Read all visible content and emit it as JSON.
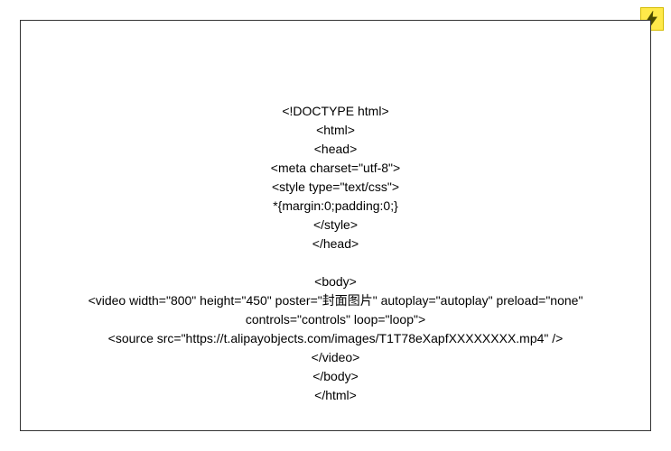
{
  "code": {
    "l1": "<!DOCTYPE html>",
    "l2": "<html>",
    "l3": "<head>",
    "l4": "<meta charset=\"utf-8\">",
    "l5": "<style type=\"text/css\">",
    "l6": "*{margin:0;padding:0;}",
    "l7": "</style>",
    "l8": "</head>",
    "l9": "<body>",
    "l10": "<video width=\"800\" height=\"450\" poster=\"封面图片\" autoplay=\"autoplay\" preload=\"none\"",
    "l11": "controls=\"controls\" loop=\"loop\">",
    "l12": "<source src=\"https://t.alipayobjects.com/images/T1T78eXapfXXXXXXXX.mp4\" />",
    "l13": "</video>",
    "l14": "</body>",
    "l15": "</html>"
  },
  "badge": {
    "icon_name": "lightning-icon"
  }
}
